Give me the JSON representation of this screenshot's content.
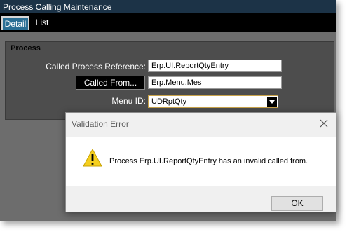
{
  "window": {
    "title": "Process Calling Maintenance"
  },
  "tabs": [
    {
      "label": "Detail",
      "selected": true
    },
    {
      "label": "List",
      "selected": false
    }
  ],
  "process_group": {
    "title": "Process",
    "called_process_reference": {
      "label": "Called Process Reference:",
      "value": "Erp.UI.ReportQtyEntry"
    },
    "called_from": {
      "button_label": "Called From...",
      "value": "Erp.Menu.Mes"
    },
    "menu_id": {
      "label": "Menu ID:",
      "value": "UDRptQty"
    }
  },
  "dialog": {
    "title": "Validation Error",
    "message": "Process Erp.UI.ReportQtyEntry has an invalid called from.",
    "ok_label": "OK",
    "icon": "warning-icon"
  },
  "colors": {
    "titlebar": "#1c3347",
    "tab_selected": "#2a6e94",
    "panel": "#6d6d6d",
    "group": "#4d4d4d",
    "warning": "#f5cf1e"
  }
}
